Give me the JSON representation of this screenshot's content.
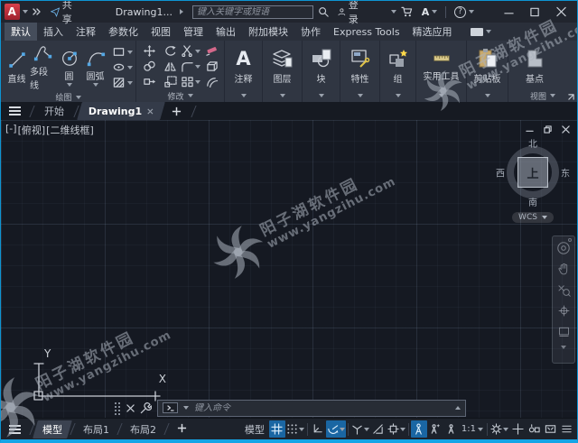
{
  "titlebar": {
    "logo_letter": "A",
    "share_label": "共享",
    "doc_title": "Drawing1...",
    "search_placeholder": "键入关键字或短语",
    "login_label": "登录",
    "autodesk_letter": "A",
    "help_glyph": "?"
  },
  "ribbon": {
    "tabs": [
      {
        "label": "默认"
      },
      {
        "label": "插入"
      },
      {
        "label": "注释"
      },
      {
        "label": "参数化"
      },
      {
        "label": "视图"
      },
      {
        "label": "管理"
      },
      {
        "label": "输出"
      },
      {
        "label": "附加模块"
      },
      {
        "label": "协作"
      },
      {
        "label": "Express Tools"
      },
      {
        "label": "精选应用"
      }
    ],
    "draw": {
      "panel_label": "绘图",
      "line": "直线",
      "polyline": "多段线",
      "circle": "圆",
      "arc": "圆弧"
    },
    "modify": {
      "panel_label": "修改"
    },
    "annotate_label": "注释",
    "annotate_icon_letter": "A",
    "layers_label": "图层",
    "block_label": "块",
    "properties_label": "特性",
    "groups_label": "组",
    "utilities_label": "实用工具",
    "clipboard_label": "剪贴板",
    "basepoint_label": "基点",
    "view_panel_label": "视图"
  },
  "file_tabs": {
    "start": "开始",
    "active_doc": "Drawing1"
  },
  "viewport": {
    "controls": {
      "menu": "[-]",
      "view": "[俯视]",
      "visual_style": "[二维线框]"
    },
    "viewcube": {
      "north": "北",
      "south": "南",
      "east": "东",
      "west": "西",
      "top": "上",
      "wcs": "WCS"
    },
    "ucs": {
      "x": "X",
      "y": "Y"
    }
  },
  "command_line": {
    "placeholder": "键入命令"
  },
  "status_bar": {
    "model_tab": "模型",
    "layout1_tab": "布局1",
    "layout2_tab": "布局2",
    "model_space_label": "模型",
    "annotation_scale": "1:1"
  },
  "watermark": {
    "line1": "阳子湖软件园",
    "line2": "www.yangzihu.com"
  }
}
